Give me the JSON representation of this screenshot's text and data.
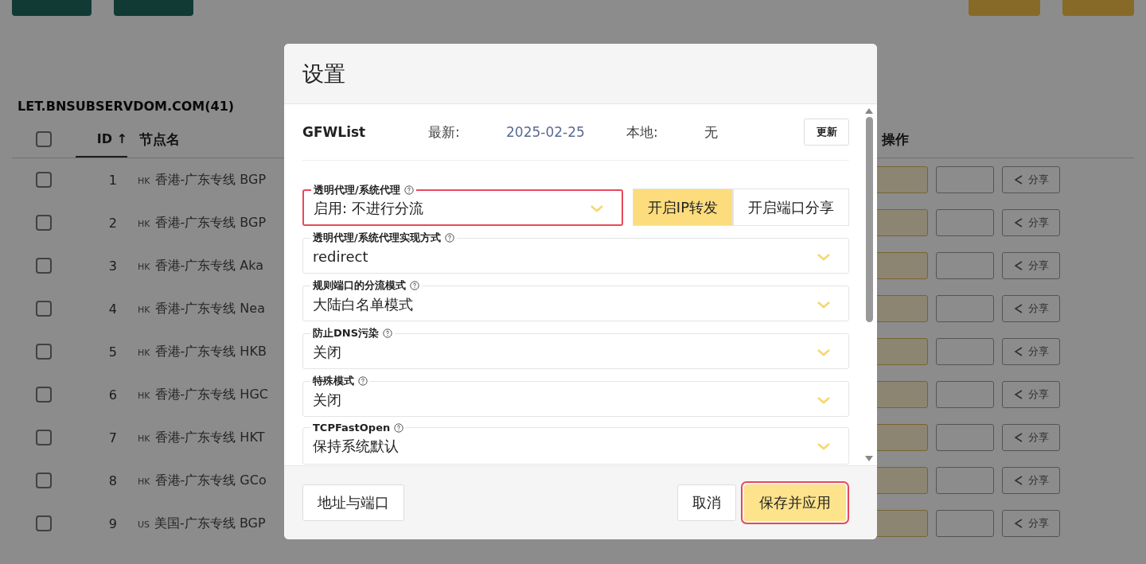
{
  "page": {
    "top_buttons": [
      {
        "kind": "teal"
      },
      {
        "kind": "teal"
      },
      {
        "kind": "amber"
      },
      {
        "kind": "amber"
      }
    ]
  },
  "table": {
    "title": "LET.BNSUBSERVDOM.COM(41)",
    "all_checked": false,
    "columns": [
      {
        "label": "ID ↑"
      },
      {
        "label": "节点名"
      },
      {
        "label": "操作"
      }
    ],
    "rows": [
      {
        "id": "1",
        "region": "HK",
        "name": "香港-广东专线 BGP",
        "checked": false,
        "actions": [
          {
            "kind": "amber"
          },
          {
            "kind": "plain"
          },
          {
            "kind": "share",
            "label": "分享"
          }
        ]
      },
      {
        "id": "2",
        "region": "HK",
        "name": "香港-广东专线 BGP",
        "checked": false,
        "actions": [
          {
            "kind": "amber"
          },
          {
            "kind": "plain"
          },
          {
            "kind": "share",
            "label": "分享"
          }
        ]
      },
      {
        "id": "3",
        "region": "HK",
        "name": "香港-广东专线 Aka",
        "checked": false,
        "actions": [
          {
            "kind": "amber"
          },
          {
            "kind": "plain"
          },
          {
            "kind": "share",
            "label": "分享"
          }
        ]
      },
      {
        "id": "4",
        "region": "HK",
        "name": "香港-广东专线 Nea",
        "checked": false,
        "actions": [
          {
            "kind": "amber"
          },
          {
            "kind": "plain"
          },
          {
            "kind": "share",
            "label": "分享"
          }
        ]
      },
      {
        "id": "5",
        "region": "HK",
        "name": "香港-广东专线 HKB",
        "checked": false,
        "actions": [
          {
            "kind": "amber"
          },
          {
            "kind": "plain"
          },
          {
            "kind": "share",
            "label": "分享"
          }
        ]
      },
      {
        "id": "6",
        "region": "HK",
        "name": "香港-广东专线 HGC",
        "checked": false,
        "actions": [
          {
            "kind": "amber"
          },
          {
            "kind": "plain"
          },
          {
            "kind": "share",
            "label": "分享"
          }
        ]
      },
      {
        "id": "7",
        "region": "HK",
        "name": "香港-广东专线 HKT",
        "checked": false,
        "actions": [
          {
            "kind": "amber"
          },
          {
            "kind": "plain"
          },
          {
            "kind": "share",
            "label": "分享"
          }
        ]
      },
      {
        "id": "8",
        "region": "HK",
        "name": "香港-广东专线 GCo",
        "checked": false,
        "actions": [
          {
            "kind": "amber"
          },
          {
            "kind": "plain"
          },
          {
            "kind": "share",
            "label": "分享"
          }
        ]
      },
      {
        "id": "9",
        "region": "US",
        "name": "美国-广东专线 BGP",
        "checked": false,
        "actions": [
          {
            "kind": "amber"
          },
          {
            "kind": "plain"
          },
          {
            "kind": "share",
            "label": "分享"
          }
        ]
      }
    ]
  },
  "dialog": {
    "title": "设置",
    "gfwlist": {
      "name": "GFWList",
      "latest_label": "最新:",
      "latest": "2025-02-25",
      "local_label": "本地:",
      "local": "无",
      "update_button": "更新"
    },
    "fields": [
      {
        "label": "透明代理/系统代理",
        "value": "启用: 不进行分流",
        "highlighted": true,
        "toggles": [
          {
            "label": "开启IP转发",
            "selected": true
          },
          {
            "label": "开启端口分享",
            "selected": false
          }
        ]
      },
      {
        "label": "透明代理/系统代理实现方式",
        "value": "redirect",
        "highlighted": false
      },
      {
        "label": "规则端口的分流模式",
        "value": "大陆白名单模式",
        "highlighted": false
      },
      {
        "label": "防止DNS污染",
        "value": "关闭",
        "highlighted": false
      },
      {
        "label": "特殊模式",
        "value": "关闭",
        "highlighted": false
      },
      {
        "label": "TCPFastOpen",
        "value": "保持系统默认",
        "highlighted": false
      }
    ],
    "footer": {
      "left_button": "地址与端口",
      "buttons": [
        {
          "label": "取消",
          "kind": "default",
          "highlighted": false
        },
        {
          "label": "保存并应用",
          "kind": "primary",
          "highlighted": true
        }
      ]
    }
  }
}
